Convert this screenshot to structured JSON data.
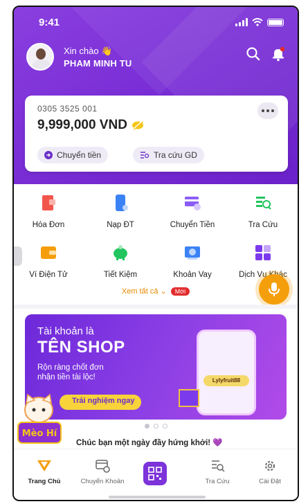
{
  "status_bar": {
    "time": "9:41"
  },
  "header": {
    "greeting": "Xin chào 👋",
    "user_name": "PHAM MINH TU"
  },
  "account_card": {
    "account_number": "0305 3525 001",
    "balance": "9,999,000 VND",
    "transfer_label": "Chuyển tiền",
    "lookup_label": "Tra cứu GD"
  },
  "services": [
    {
      "label": "Hóa Đơn",
      "icon": "bill-icon",
      "color": "#f2554b"
    },
    {
      "label": "Nạp ĐT",
      "icon": "phone-topup-icon",
      "color": "#3b82f6"
    },
    {
      "label": "Chuyển Tiền",
      "icon": "transfer-card-icon",
      "color": "#8b5cf6"
    },
    {
      "label": "Tra Cứu",
      "icon": "lookup-icon",
      "color": "#22c55e"
    },
    {
      "label": "Ví Điện Tử",
      "icon": "wallet-icon",
      "color": "#f59e0b"
    },
    {
      "label": "Tiết Kiệm",
      "icon": "piggy-bank-icon",
      "color": "#22c55e"
    },
    {
      "label": "Khoản Vay",
      "icon": "loan-icon",
      "color": "#3b82f6"
    },
    {
      "label": "Dịch Vụ Khác",
      "icon": "other-services-icon",
      "color": "#7c3aed"
    }
  ],
  "see_all": {
    "label": "Xem tất cả ⌄",
    "badge": "Mới"
  },
  "banner": {
    "line1": "Tài khoản là",
    "line2": "TÊN SHOP",
    "line3a": "Rộn ràng chốt đơn",
    "line3b": "nhận tiền tài lộc!",
    "cta": "Trải nghiệm ngay",
    "shop_name": "Lylyfruit88",
    "mascot_text": "Mèo Hí"
  },
  "wish": "Chúc bạn một ngày đầy hứng khởi! 💜",
  "tabs": [
    {
      "label": "Trang Chủ",
      "icon": "home-icon"
    },
    {
      "label": "Chuyển Khoản",
      "icon": "transfer-icon"
    },
    {
      "label": "",
      "icon": "qr-scan-icon"
    },
    {
      "label": "Tra Cứu",
      "icon": "lookup-icon"
    },
    {
      "label": "Cài Đặt",
      "icon": "settings-icon"
    }
  ],
  "colors": {
    "brand": "#7a2fd6",
    "accent": "#f59e0b",
    "badge": "#e32b2b"
  }
}
